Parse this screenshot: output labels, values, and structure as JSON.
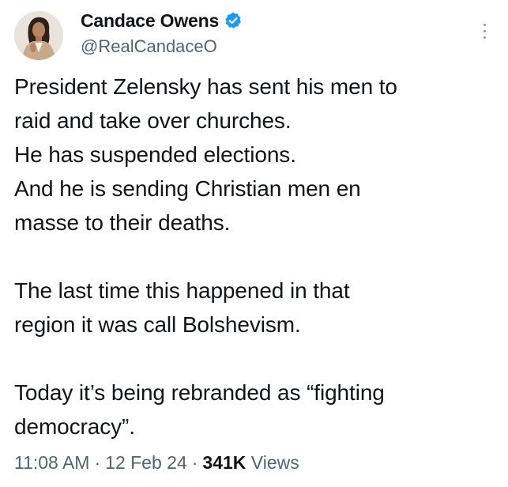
{
  "author": {
    "display_name": "Candace Owens",
    "handle": "@RealCandaceO",
    "verified": true,
    "verified_color": "#1d9bf0"
  },
  "tweet": {
    "lines": [
      "President Zelensky has sent his men to",
      "raid and take over churches.",
      "He has suspended elections.",
      "And he is sending Christian men en",
      "masse to their deaths.",
      "",
      "The last time this happened in that",
      "region it was call Bolshevism.",
      "",
      "Today it’s being rebranded as “fighting",
      "democracy”."
    ]
  },
  "meta": {
    "time": "11:08 AM",
    "date": "12 Feb 24",
    "separator": "·",
    "views_count": "341K",
    "views_label": "Views"
  },
  "icons": {
    "more": "more-vertical-icon",
    "verified": "verified-badge-icon"
  }
}
